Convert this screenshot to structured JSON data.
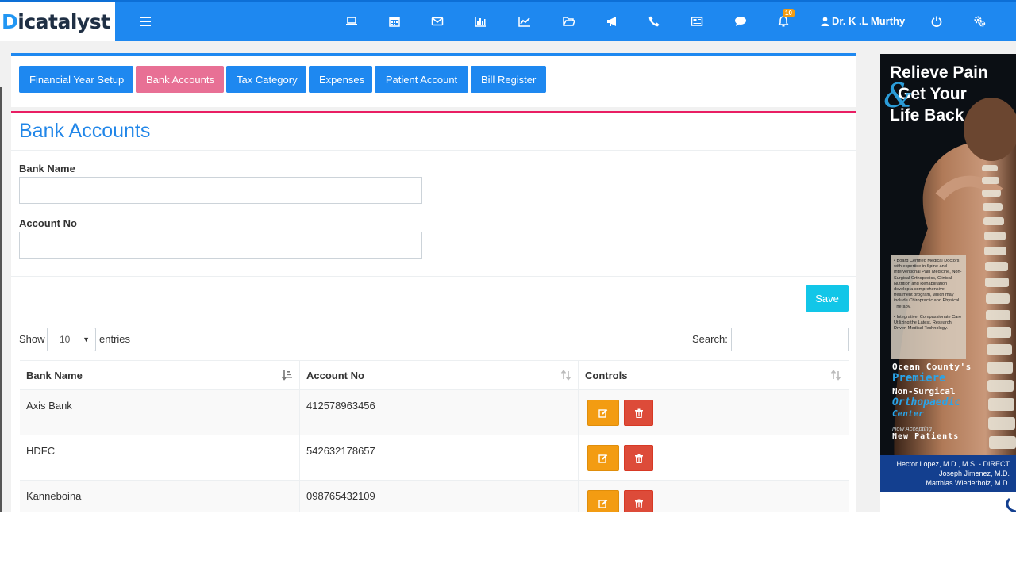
{
  "brand": {
    "logo_text_main": "icatalyst",
    "logo_text_first": "D"
  },
  "navbar": {
    "icons": [
      "laptop-icon",
      "calendar-icon",
      "envelope-icon",
      "bar-chart-icon",
      "line-chart-icon",
      "folder-open-icon",
      "bullhorn-icon",
      "phone-icon",
      "newspaper-icon",
      "comment-icon",
      "bell-icon",
      "power-icon",
      "users-cog-icon"
    ],
    "notification_count": "10",
    "user_name": "Dr. K .L Murthy"
  },
  "tabs": [
    {
      "label": "Financial Year Setup",
      "active": false
    },
    {
      "label": "Bank Accounts",
      "active": true
    },
    {
      "label": "Tax Category",
      "active": false
    },
    {
      "label": "Expenses",
      "active": false
    },
    {
      "label": "Patient Account",
      "active": false
    },
    {
      "label": "Bill Register",
      "active": false
    }
  ],
  "form": {
    "title": "Bank Accounts",
    "bank_name_label": "Bank Name",
    "bank_name_value": "",
    "account_no_label": "Account No",
    "account_no_value": "",
    "save_label": "Save"
  },
  "table_controls": {
    "show_label": "Show",
    "entries_value": "10",
    "entries_label": "entries",
    "search_label": "Search:",
    "search_value": ""
  },
  "table": {
    "headers": [
      "Bank Name",
      "Account No",
      "Controls"
    ],
    "rows": [
      {
        "bank_name": "Axis Bank",
        "account_no": "412578963456"
      },
      {
        "bank_name": "HDFC",
        "account_no": "542632178657"
      },
      {
        "bank_name": "Kanneboina",
        "account_no": "098765432109"
      }
    ]
  },
  "advertisement": {
    "headline": [
      "Relieve Pain",
      "Get Your",
      "Life Back"
    ],
    "ampersand": "&",
    "bullet_1": "Board Certified Medical Doctors with expertise in Spine and Interventional Pain Medicine, Non-Surgical Orthopedics, Clinical Nutrition and Rehabilitation develop a comprehensive treatment program, which may include Chiropractic and Physical Therapy.",
    "bullet_2": "Integrative, Compassionate Care Utilizing the Latest, Research Driven Medical Technology.",
    "line1": "Ocean County's",
    "line2": "Premiere",
    "line3": "Non-Surgical",
    "line4": "Orthopaedic",
    "line5": "Center",
    "line6": "Now Accepting",
    "line7": "New Patients",
    "doctors": [
      "Hector Lopez, M.D., M.S. - DIRECT",
      "Joseph Jimenez, M.D.",
      "Matthias Wiederholz, M.D."
    ]
  },
  "colors": {
    "primary": "#1e88f0",
    "active_tab": "#e87095",
    "save": "#12c6e8",
    "edit": "#f39c12",
    "delete": "#dd4b39",
    "panel_accent": "#e91e63"
  }
}
